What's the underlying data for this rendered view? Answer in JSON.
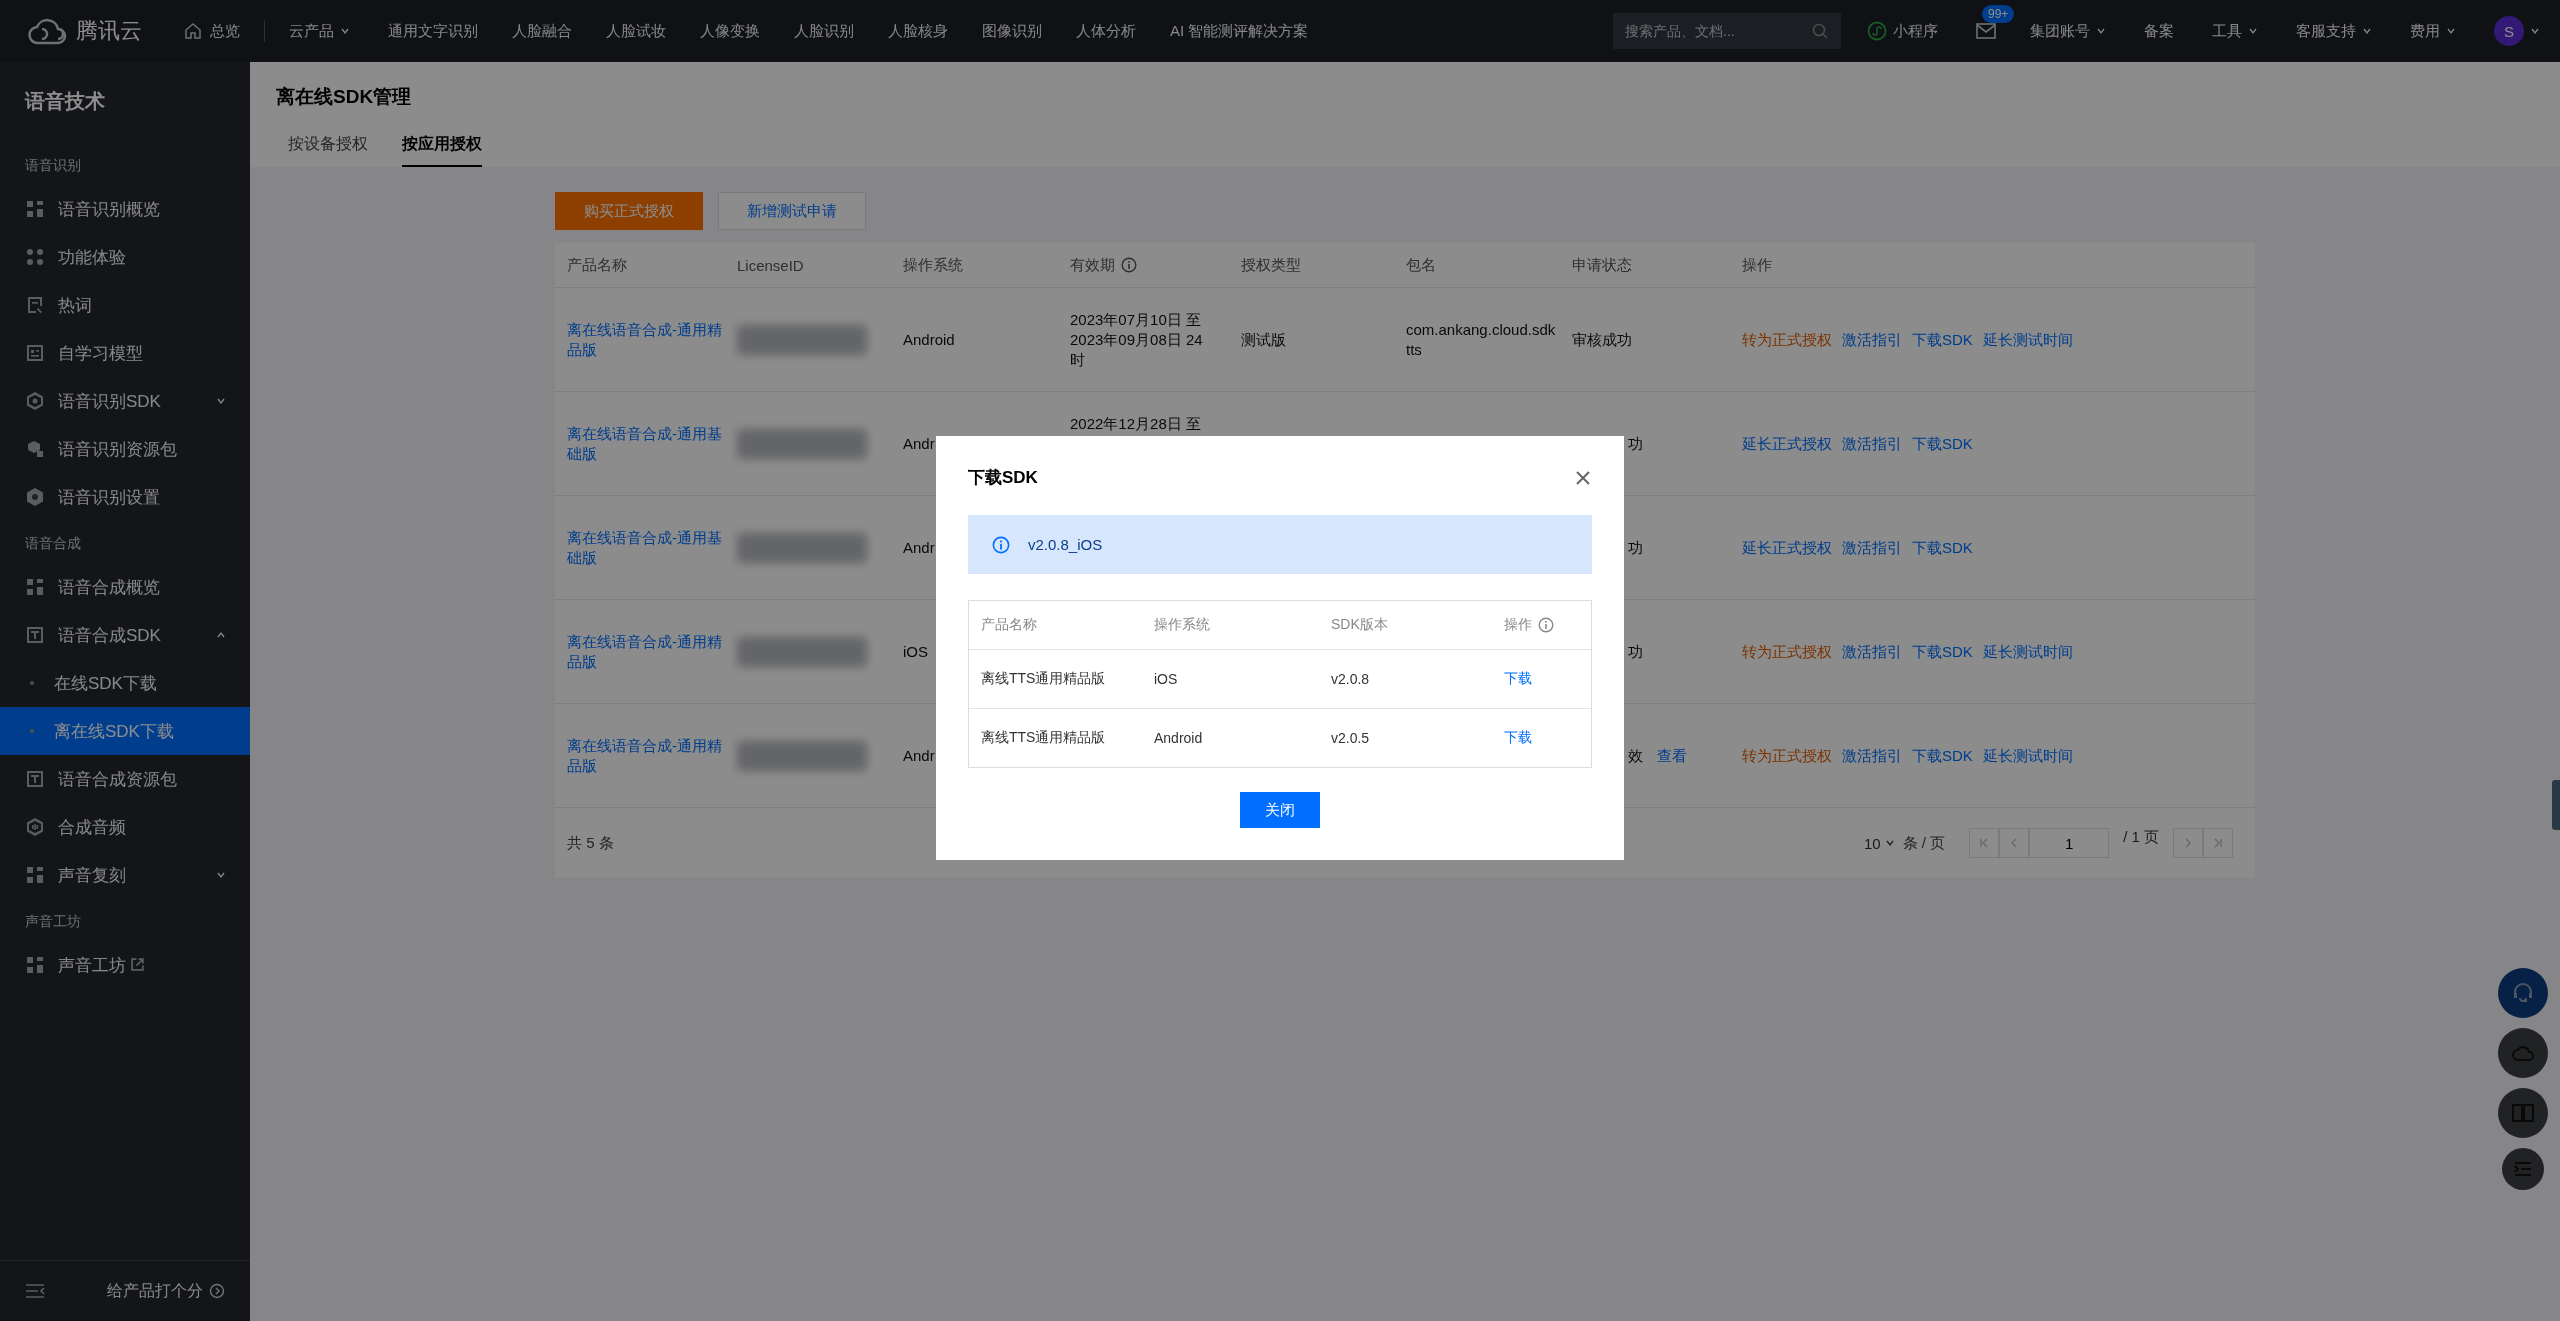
{
  "header": {
    "logo": "腾讯云",
    "home": "总览",
    "products": "云产品",
    "nav": [
      "通用文字识别",
      "人脸融合",
      "人脸试妆",
      "人像变换",
      "人脸识别",
      "人脸核身",
      "图像识别",
      "人体分析",
      "AI 智能测评解决方案"
    ],
    "search": {
      "placeholder": "搜索产品、文档..."
    },
    "mini_program": "小程序",
    "mail_badge": "99+",
    "menus": [
      {
        "label": "集团账号",
        "dropdown": true
      },
      {
        "label": "备案",
        "dropdown": false
      },
      {
        "label": "工具",
        "dropdown": true
      },
      {
        "label": "客服支持",
        "dropdown": true
      },
      {
        "label": "费用",
        "dropdown": true
      }
    ],
    "avatar": "S"
  },
  "sidebar": {
    "title": "语音技术",
    "groups": [
      {
        "label": "语音识别",
        "items": [
          {
            "label": "语音识别概览",
            "selected": false
          },
          {
            "label": "功能体验",
            "selected": false
          },
          {
            "label": "热词",
            "selected": false
          },
          {
            "label": "自学习模型",
            "selected": false
          },
          {
            "label": "语音识别SDK",
            "selected": false,
            "expanded": false
          },
          {
            "label": "语音识别资源包",
            "selected": false
          },
          {
            "label": "语音识别设置",
            "selected": false
          }
        ]
      },
      {
        "label": "语音合成",
        "items": [
          {
            "label": "语音合成概览",
            "selected": false
          },
          {
            "label": "语音合成SDK",
            "selected": false,
            "expanded": true,
            "children": [
              {
                "label": "在线SDK下载",
                "selected": false
              },
              {
                "label": "离在线SDK下载",
                "selected": true
              }
            ]
          },
          {
            "label": "语音合成资源包",
            "selected": false
          },
          {
            "label": "合成音频",
            "selected": false
          },
          {
            "label": "声音复刻",
            "selected": false,
            "expanded": false
          }
        ]
      },
      {
        "label": "声音工坊",
        "items": [
          {
            "label": "声音工坊",
            "selected": false,
            "external": true
          }
        ]
      }
    ],
    "rate": "给产品打个分"
  },
  "page_title": "离在线SDK管理",
  "tabs": [
    {
      "label": "按设备授权",
      "selected": false
    },
    {
      "label": "按应用授权",
      "selected": true
    }
  ],
  "actions": [
    {
      "label": "购买正式授权",
      "kind": "primary"
    },
    {
      "label": "新增测试申请",
      "kind": "secondary"
    }
  ],
  "table": {
    "columns": [
      {
        "label": "产品名称",
        "info": false
      },
      {
        "label": "LicenseID",
        "info": false
      },
      {
        "label": "操作系统",
        "info": false
      },
      {
        "label": "有效期",
        "info": true
      },
      {
        "label": "授权类型",
        "info": false
      },
      {
        "label": "包名",
        "info": false
      },
      {
        "label": "申请状态",
        "info": false
      },
      {
        "label": "操作",
        "info": false
      }
    ],
    "rows": [
      {
        "product": "离在线语音合成-通用精品版",
        "os": "Android",
        "validity": [
          "2023年07月10日 至",
          "2023年09月08日 24",
          "时"
        ],
        "type": "测试版",
        "package": "com.ankang.cloud.sdktts",
        "status": "审核成功",
        "clipped": false,
        "ops": [
          {
            "label": "转为正式授权",
            "kind": "warning"
          },
          {
            "label": "激活指引",
            "kind": "link"
          },
          {
            "label": "下载SDK",
            "kind": "link"
          },
          {
            "label": "延长测试时间",
            "kind": "link"
          }
        ]
      },
      {
        "product": "离在线语音合成-通用基础版",
        "os": "Andr",
        "validity": [
          "2022年12月28日 至"
        ],
        "status": "功",
        "clipped": true,
        "ops": [
          {
            "label": "延长正式授权",
            "kind": "link"
          },
          {
            "label": "激活指引",
            "kind": "link"
          },
          {
            "label": "下载SDK",
            "kind": "link"
          }
        ]
      },
      {
        "product": "离在线语音合成-通用基础版",
        "os": "Andr",
        "status": "功",
        "clipped": true,
        "ops": [
          {
            "label": "延长正式授权",
            "kind": "link"
          },
          {
            "label": "激活指引",
            "kind": "link"
          },
          {
            "label": "下载SDK",
            "kind": "link"
          }
        ]
      },
      {
        "product": "离在线语音合成-通用精品版",
        "os": "iOS",
        "status": "功",
        "clipped": true,
        "ops": [
          {
            "label": "转为正式授权",
            "kind": "warning"
          },
          {
            "label": "激活指引",
            "kind": "link"
          },
          {
            "label": "下载SDK",
            "kind": "link"
          },
          {
            "label": "延长测试时间",
            "kind": "link"
          }
        ]
      },
      {
        "product": "离在线语音合成-通用精品版",
        "os": "Andr",
        "status": "效",
        "clipped": true,
        "status_link": "查看",
        "ops": [
          {
            "label": "转为正式授权",
            "kind": "warning"
          },
          {
            "label": "激活指引",
            "kind": "link"
          },
          {
            "label": "下载SDK",
            "kind": "link"
          },
          {
            "label": "延长测试时间",
            "kind": "link"
          }
        ]
      }
    ],
    "total": "共 5 条"
  },
  "pagination": {
    "page_size": "10",
    "per_page": "条 / 页",
    "page": "1",
    "pages": "/ 1 页"
  },
  "dialog": {
    "title": "下载SDK",
    "notice": "v2.0.8_iOS",
    "columns": [
      {
        "label": "产品名称",
        "info": false
      },
      {
        "label": "操作系统",
        "info": false
      },
      {
        "label": "SDK版本",
        "info": false
      },
      {
        "label": "操作",
        "info": true
      }
    ],
    "rows": [
      {
        "product": "离线TTS通用精品版",
        "os": "iOS",
        "version": "v2.0.8",
        "action": "下载"
      },
      {
        "product": "离线TTS通用精品版",
        "os": "Android",
        "version": "v2.0.5",
        "action": "下载"
      }
    ],
    "close": "关闭"
  }
}
